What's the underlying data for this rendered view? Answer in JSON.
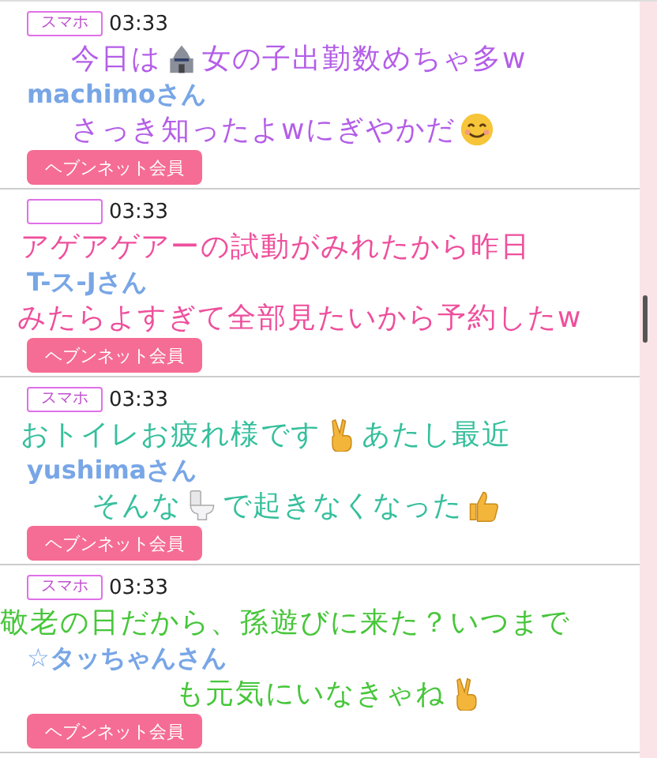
{
  "posts": [
    {
      "tag": "スマホ",
      "time": "03:33",
      "name": "machimoさん",
      "button": "ヘブンネット会員",
      "caption": {
        "color": "#b45ee8",
        "lines": [
          [
            {
              "kind": "text",
              "text": "今日は"
            },
            {
              "kind": "castle"
            },
            {
              "kind": "text",
              "text": "女の子出勤数めちゃ多w"
            }
          ],
          [
            {
              "kind": "text",
              "text": "さっき知ったよwにぎやかだ"
            },
            {
              "kind": "smile"
            }
          ]
        ]
      }
    },
    {
      "time": "03:33",
      "name": "T-ス-Jさん",
      "button": "ヘブンネット会員",
      "caption": {
        "color": "#ee4f9c",
        "lines": [
          [
            {
              "kind": "text",
              "text": "アゲアゲアーの試動がみれたから昨日"
            }
          ],
          [
            {
              "kind": "text",
              "text": "みたらよすぎて全部見たいから予約したw"
            }
          ]
        ]
      }
    },
    {
      "tag": "スマホ",
      "time": "03:33",
      "name": "yushimaさん",
      "button": "ヘブンネット会員",
      "caption": {
        "color": "#35bf9c",
        "lines": [
          [
            {
              "kind": "text",
              "text": "おトイレお疲れ様です"
            },
            {
              "kind": "victory"
            },
            {
              "kind": "text",
              "text": "あたし最近"
            }
          ],
          [
            {
              "kind": "text",
              "text": "そんな"
            },
            {
              "kind": "toilet"
            },
            {
              "kind": "text",
              "text": "で起きなくなった"
            },
            {
              "kind": "thumbs"
            }
          ]
        ]
      }
    },
    {
      "tag": "スマホ",
      "time": "03:33",
      "name": "☆タッちゃんさん",
      "button": "ヘブンネット会員",
      "caption": {
        "color": "#47c63a",
        "lines": [
          [
            {
              "kind": "text",
              "text": "敬老の日だから、孫遊びに来た？いつまで"
            }
          ],
          [
            {
              "kind": "text",
              "text": "も元気にいなきゃね"
            },
            {
              "kind": "victory"
            }
          ]
        ]
      }
    }
  ]
}
